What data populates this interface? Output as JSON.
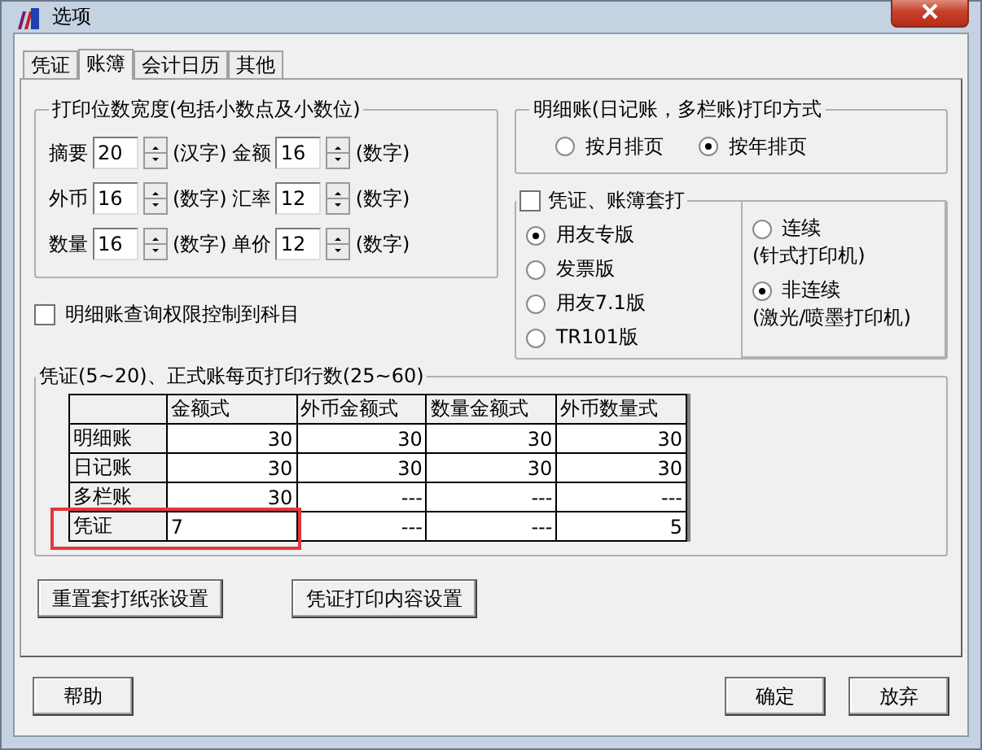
{
  "window": {
    "title": "选项"
  },
  "tabs": [
    {
      "label": "凭证",
      "selected": false
    },
    {
      "label": "账簿",
      "selected": true
    },
    {
      "label": "会计日历",
      "selected": false
    },
    {
      "label": "其他",
      "selected": false
    }
  ],
  "print_width": {
    "title": "打印位数宽度(包括小数点及小数位)",
    "rows": [
      [
        {
          "label": "摘要",
          "value": "20",
          "unit": "(汉字)"
        },
        {
          "label": "金额",
          "value": "16",
          "unit": "(数字)"
        }
      ],
      [
        {
          "label": "外币",
          "value": "16",
          "unit": "(数字)"
        },
        {
          "label": "汇率",
          "value": "12",
          "unit": "(数字)"
        }
      ],
      [
        {
          "label": "数量",
          "value": "16",
          "unit": "(数字)"
        },
        {
          "label": "单价",
          "value": "12",
          "unit": "(数字)"
        }
      ]
    ]
  },
  "query_limit": {
    "label": "明细账查询权限控制到科目",
    "checked": false
  },
  "ledger_mode": {
    "title": "明细账(日记账，多栏账)打印方式",
    "options": [
      {
        "label": "按月排页",
        "selected": false
      },
      {
        "label": "按年排页",
        "selected": true
      }
    ]
  },
  "overprint": {
    "label": "凭证、账簿套打",
    "checked": false,
    "versions": [
      {
        "label": "用友专版",
        "selected": true
      },
      {
        "label": "发票版",
        "selected": false
      },
      {
        "label": "用友7.1版",
        "selected": false
      },
      {
        "label": "TR101版",
        "selected": false
      }
    ],
    "printers": [
      {
        "label": "连续",
        "note": "(针式打印机)",
        "selected": false
      },
      {
        "label": "非连续",
        "note": "(激光/喷墨打印机)",
        "selected": true
      }
    ]
  },
  "rows_per_page": {
    "title": "凭证(5~20)、正式账每页打印行数(25~60)",
    "columns": [
      "金额式",
      "外币金额式",
      "数量金额式",
      "外币数量式"
    ],
    "rows": [
      {
        "label": "明细账",
        "cells": [
          "30",
          "30",
          "30",
          "30"
        ],
        "highlighted": false
      },
      {
        "label": "日记账",
        "cells": [
          "30",
          "30",
          "30",
          "30"
        ],
        "highlighted": false
      },
      {
        "label": "多栏账",
        "cells": [
          "30",
          "---",
          "---",
          "---"
        ],
        "highlighted": false
      },
      {
        "label": "凭证",
        "cells": [
          "7",
          "---",
          "---",
          "5"
        ],
        "highlighted": true
      }
    ]
  },
  "setting_buttons": [
    "重置套打纸张设置",
    "凭证打印内容设置"
  ],
  "footer": {
    "help": "帮助",
    "ok": "确定",
    "cancel": "放弃"
  }
}
